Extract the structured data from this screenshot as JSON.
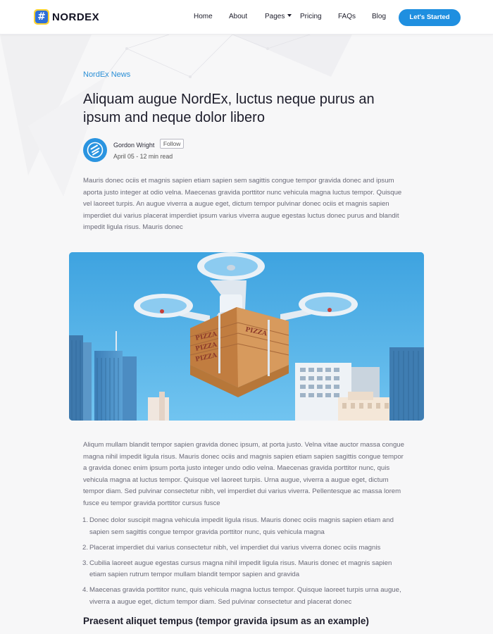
{
  "brand": {
    "name": "NORDEX",
    "mark_glyph": "#",
    "colors": {
      "mark_bg": "#2f6fd8",
      "mark_border": "#ffd233",
      "accent": "#1f8fe0"
    }
  },
  "nav": {
    "items": [
      {
        "label": "Home"
      },
      {
        "label": "About"
      },
      {
        "label": "Pages"
      },
      {
        "label": "Pricing"
      },
      {
        "label": "FAQs"
      },
      {
        "label": "Blog"
      }
    ],
    "cta_label": "Let's Started"
  },
  "article": {
    "category": "NordEx News",
    "title": "Aliquam augue NordEx, luctus neque purus an ipsum and neque dolor libero",
    "author": {
      "name": "Gordon Wright",
      "follow_label": "Follow",
      "date": "April 05 - 12 min read",
      "avatar_icon": "stack-logo-icon"
    },
    "intro": "Mauris donec ociis et magnis sapien etiam sapien sem sagittis congue tempor gravida donec and ipsum aporta justo integer at odio velna. Maecenas gravida porttitor nunc vehicula magna luctus tempor. Quisque vel laoreet turpis. An augue viverra a augue eget, dictum tempor pulvinar donec ociis et magnis sapien imperdiet dui varius placerat imperdiet ipsum varius viverra augue egestas luctus donec purus and blandit impedit ligula risus. Mauris donec",
    "hero": {
      "icon": "drone-delivering-pizza-illustration",
      "box_lettering": "PIZZA"
    },
    "body": "Aliqum mullam blandit tempor sapien gravida donec ipsum, at porta justo. Velna vitae auctor massa congue magna nihil impedit ligula risus. Mauris donec ociis and magnis sapien etiam sapien sagittis congue tempor a gravida donec enim ipsum porta justo integer undo odio velna. Maecenas gravida porttitor nunc, quis vehicula magna at luctus tempor. Quisque vel laoreet turpis. Urna augue, viverra a augue eget, dictum tempor diam. Sed pulvinar consectetur nibh, vel imperdiet dui varius viverra. Pellentesque ac massa lorem fusce eu tempor gravida porttitor cursus fusce",
    "list": [
      {
        "num": "1.",
        "text": "Donec dolor suscipit magna vehicula impedit ligula risus. Mauris donec ociis magnis sapien etiam and sapien sem sagittis congue tempor gravida porttitor nunc, quis vehicula magna"
      },
      {
        "num": "2.",
        "text": "Placerat imperdiet dui varius consectetur nibh, vel imperdiet dui varius viverra donec ociis magnis"
      },
      {
        "num": "3.",
        "text": "Cubilia laoreet augue egestas cursus magna nihil impedit ligula risus. Mauris donec et magnis sapien etiam sapien rutrum tempor mullam blandit tempor sapien and gravida"
      },
      {
        "num": "4.",
        "text": "Maecenas gravida porttitor nunc, quis vehicula magna luctus tempor. Quisque laoreet turpis urna augue, viverra a augue eget, dictum tempor diam. Sed pulvinar consectetur and placerat donec"
      }
    ],
    "subheading": "Praesent aliquet tempus (tempor gravida ipsum as an example)"
  }
}
